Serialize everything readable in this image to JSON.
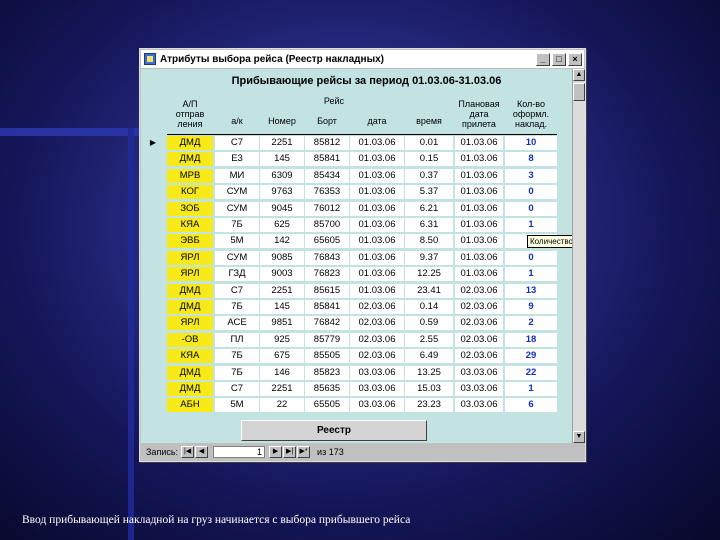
{
  "window": {
    "title": "Атрибуты выбора рейса (Реестр накладных)",
    "buttons": {
      "minimize": "_",
      "maximize": "□",
      "close": "×"
    }
  },
  "report": {
    "title": "Прибывающие рейсы за период 01.03.06-31.03.06",
    "headers": {
      "ap": "А/П отправ ления",
      "reis_group": "Рейс",
      "ak": "а/к",
      "nomer": "Номер",
      "bort": "Борт",
      "data": "дата",
      "vremya": "время",
      "plan": "Плановая дата прилета",
      "kolvo": "Кол-во оформл. наклад."
    },
    "rows": [
      {
        "ap": "ДМД",
        "ak": "С7",
        "nomer": "2251",
        "bort": "85812",
        "data": "01.03.06",
        "vremya": "0.01",
        "plan": "01.03.06",
        "kolvo": "10"
      },
      {
        "ap": "ДМД",
        "ak": "Е3",
        "nomer": "145",
        "bort": "85841",
        "data": "01.03.06",
        "vremya": "0.15",
        "plan": "01.03.06",
        "kolvo": "8"
      },
      {
        "ap": "МРВ",
        "ak": "МИ",
        "nomer": "6309",
        "bort": "85434",
        "data": "01.03.06",
        "vremya": "0.37",
        "plan": "01.03.06",
        "kolvo": "3"
      },
      {
        "ap": "КОГ",
        "ak": "СУМ",
        "nomer": "9763",
        "bort": "76353",
        "data": "01.03.06",
        "vremya": "5.37",
        "plan": "01.03.06",
        "kolvo": "0"
      },
      {
        "ap": "ЗОБ",
        "ak": "СУМ",
        "nomer": "9045",
        "bort": "76012",
        "data": "01.03.06",
        "vremya": "6.21",
        "plan": "01.03.06",
        "kolvo": "0"
      },
      {
        "ap": "КЯА",
        "ak": "7Б",
        "nomer": "625",
        "bort": "85700",
        "data": "01.03.06",
        "vremya": "6.31",
        "plan": "01.03.06",
        "kolvo": "1"
      },
      {
        "ap": "ЭВБ",
        "ak": "5М",
        "nomer": "142",
        "bort": "65605",
        "data": "01.03.06",
        "vremya": "8.50",
        "plan": "01.03.06",
        "kolvo": "7"
      },
      {
        "ap": "ЯРЛ",
        "ak": "СУМ",
        "nomer": "9085",
        "bort": "76843",
        "data": "01.03.06",
        "vremya": "9.37",
        "plan": "01.03.06",
        "kolvo": "0"
      },
      {
        "ap": "ЯРЛ",
        "ak": "ГЗД",
        "nomer": "9003",
        "bort": "76823",
        "data": "01.03.06",
        "vremya": "12.25",
        "plan": "01.03.06",
        "kolvo": "1"
      },
      {
        "ap": "ДМД",
        "ak": "С7",
        "nomer": "2251",
        "bort": "85615",
        "data": "01.03.06",
        "vremya": "23.41",
        "plan": "02.03.06",
        "kolvo": "13"
      },
      {
        "ap": "ДМД",
        "ak": "7Б",
        "nomer": "145",
        "bort": "85841",
        "data": "02.03.06",
        "vremya": "0.14",
        "plan": "02.03.06",
        "kolvo": "9"
      },
      {
        "ap": "ЯРЛ",
        "ak": "АСЕ",
        "nomer": "9851",
        "bort": "76842",
        "data": "02.03.06",
        "vremya": "0.59",
        "plan": "02.03.06",
        "kolvo": "2"
      },
      {
        "ap": "-ОВ",
        "ak": "ПЛ",
        "nomer": "925",
        "bort": "85779",
        "data": "02.03.06",
        "vremya": "2.55",
        "plan": "02.03.06",
        "kolvo": "18"
      },
      {
        "ap": "КЯА",
        "ak": "7Б",
        "nomer": "675",
        "bort": "85505",
        "data": "02.03.06",
        "vremya": "6.49",
        "plan": "02.03.06",
        "kolvo": "29"
      },
      {
        "ap": "ДМД",
        "ak": "7Б",
        "nomer": "146",
        "bort": "85823",
        "data": "03.03.06",
        "vremya": "13.25",
        "plan": "03.03.06",
        "kolvo": "22"
      },
      {
        "ap": "ДМД",
        "ak": "С7",
        "nomer": "2251",
        "bort": "85635",
        "data": "03.03.06",
        "vremya": "15.03",
        "plan": "03.03.06",
        "kolvo": "1"
      },
      {
        "ap": "АБН",
        "ak": "5М",
        "nomer": "22",
        "bort": "65505",
        "data": "03.03.06",
        "vremya": "23.23",
        "plan": "03.03.06",
        "kolvo": "6"
      }
    ],
    "selected_row_marker": "▶",
    "tooltip": "Количество с"
  },
  "reestr_button": "Реестр",
  "navigation": {
    "label": "Запись:",
    "current": "1",
    "of_label": "из 173",
    "first": "|◀",
    "prev": "◀",
    "next": "▶",
    "last": "▶|",
    "new": "▶*"
  },
  "caption": "Ввод прибывающей накладной на груз начинается с выбора прибывшего рейса",
  "colors": {
    "background": "#1a1c6a",
    "form": "#c3e3e3",
    "ap_cells": "#f7ea18",
    "count_text": "#1030c0"
  }
}
